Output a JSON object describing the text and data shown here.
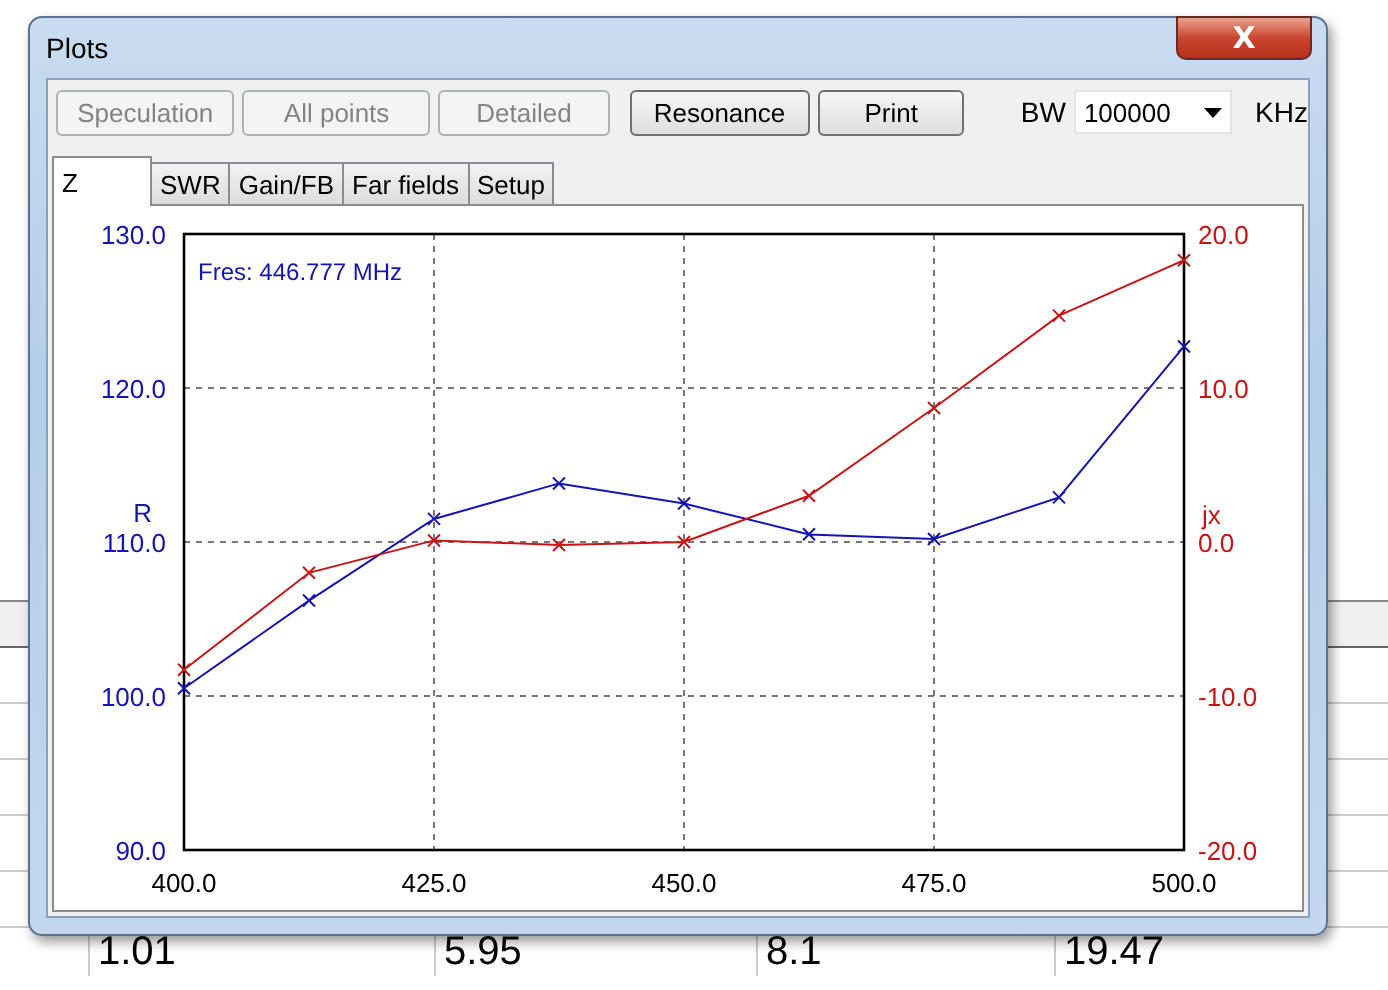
{
  "background_app": {
    "table": {
      "rows": [
        {
          "cells": [
            "1.01",
            "5.95",
            "8.1",
            "19.47"
          ]
        }
      ]
    }
  },
  "window": {
    "title": "Plots",
    "close_label": "X"
  },
  "toolbar": {
    "buttons": [
      {
        "label": "Speculation",
        "disabled": true
      },
      {
        "label": "All points",
        "disabled": true
      },
      {
        "label": "Detailed",
        "disabled": true
      },
      {
        "label": "Resonance",
        "disabled": false
      },
      {
        "label": "Print",
        "disabled": false
      }
    ],
    "bw_label": "BW",
    "bw_value": "100000",
    "bw_unit": "KHz"
  },
  "tabs": [
    {
      "label": "Z",
      "selected": true
    },
    {
      "label": "SWR",
      "selected": false
    },
    {
      "label": "Gain/FB",
      "selected": false
    },
    {
      "label": "Far fields",
      "selected": false
    },
    {
      "label": "Setup",
      "selected": false
    }
  ],
  "plot": {
    "chart_data": {
      "type": "line",
      "grid": true,
      "x": [
        400,
        412.5,
        425,
        437.5,
        450,
        462.5,
        475,
        487.5,
        500
      ],
      "series": [
        {
          "name": "R",
          "color": "#1414b4",
          "marker": "x",
          "values": [
            100.5,
            106.2,
            111.5,
            113.8,
            112.5,
            110.5,
            110.2,
            112.9,
            122.7
          ]
        }
      ],
      "xlim": [
        400,
        500
      ],
      "ylim": [
        90,
        130
      ],
      "xticks": [
        {
          "value": 400,
          "label": "400.0"
        },
        {
          "value": 425,
          "label": "425.0"
        },
        {
          "value": 450,
          "label": "450.0"
        },
        {
          "value": 475,
          "label": "475.0"
        },
        {
          "value": 500,
          "label": "500.0"
        }
      ],
      "yticks": [
        {
          "value": 90,
          "label": "90.0"
        },
        {
          "value": 100,
          "label": "100.0"
        },
        {
          "value": 110,
          "label": "110.0"
        },
        {
          "value": 120,
          "label": "120.0"
        },
        {
          "value": 130,
          "label": "130.0"
        }
      ],
      "annotations": [
        "Fres: 446.777 MHz"
      ]
    },
    "jx": {
      "chart_data": {
        "type": "line",
        "x": [
          400,
          412.5,
          425,
          437.5,
          450,
          462.5,
          475,
          487.5,
          500
        ],
        "series": [
          {
            "name": "jx",
            "color": "#c81414",
            "marker": "x",
            "values": [
              -8.3,
              -2.0,
              0.1,
              -0.2,
              0.0,
              3.0,
              8.7,
              14.7,
              18.3
            ]
          }
        ],
        "xlim": [
          400,
          500
        ],
        "ylim": [
          -20,
          20
        ],
        "yticks": [
          {
            "value": -20,
            "label": "-20.0"
          },
          {
            "value": -10,
            "label": "-10.0"
          },
          {
            "value": 0,
            "label": "0.0"
          },
          {
            "value": 10,
            "label": "10.0"
          },
          {
            "value": 20,
            "label": "20.0"
          }
        ]
      }
    }
  }
}
